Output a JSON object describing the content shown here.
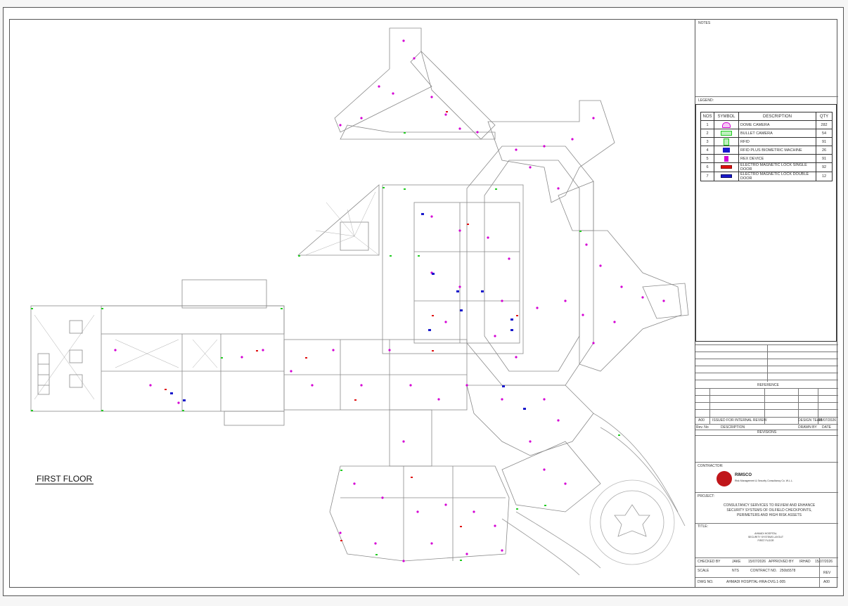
{
  "sheet": {
    "notes_label": "NOTES",
    "legend_label": "LEGEND:",
    "floor_title": "FIRST FLOOR"
  },
  "legend": {
    "headers": [
      "NOS",
      "SYMBOL",
      "DESCRIPTION",
      "QTY"
    ],
    "rows": [
      {
        "nos": "1",
        "description": "DOME CAMERA",
        "qty": "282",
        "color": "#d400d4",
        "icon": "dome-camera-icon"
      },
      {
        "nos": "2",
        "description": "BULLET CAMERA",
        "qty": "54",
        "color": "#22cc22",
        "icon": "bullet-camera-icon"
      },
      {
        "nos": "3",
        "description": "RFID",
        "qty": "91",
        "color": "#22cc22",
        "icon": "rfid-icon"
      },
      {
        "nos": "4",
        "description": "RFID PLUS BIOMETRIC MACHINE",
        "qty": "26",
        "color": "#1a1acc",
        "icon": "rfid-biometric-icon"
      },
      {
        "nos": "5",
        "description": "REX DEVICE",
        "qty": "91",
        "color": "#d400d4",
        "icon": "rex-device-icon"
      },
      {
        "nos": "6",
        "description": "ELECTRO MAGNETIC LOCK SINGLE DOOR",
        "qty": "92",
        "color": "#e01010",
        "icon": "maglock-single-icon"
      },
      {
        "nos": "7",
        "description": "ELECTRO MAGNETIC LOCK DOUBLE DOOR",
        "qty": "12",
        "color": "#1a1acc",
        "icon": "maglock-double-icon"
      }
    ]
  },
  "titleblock": {
    "reference_label": "REFERENCE",
    "revisions_label": "REVISIONS",
    "rev": {
      "no": "A00",
      "description": "ISSUED FOR INTERNAL REVIEW",
      "drawn_by": "DESIGN TEAM",
      "date": "15/07/2026"
    },
    "rev_headers": {
      "no": "Rev. No",
      "description": "DESCRIPTION",
      "drawn_by": "DRAWN BY",
      "date": "DATE"
    },
    "contractor_label": "CONTRACTOR:",
    "contractor_name": "RIMSCO",
    "contractor_sub": "Risk Management & Security Consultancy Co. W.L.L.",
    "project_label": "PROJECT:",
    "project_text": "CONSULTANCY SERVICES TO REVIEW AND ENHANCE SECURITY SYSTEMS OF OILFIELD CHECKPOINTS, PERIMETERS AND HIGH RISK ASSETS",
    "title_label": "TITLE:",
    "title_lines": [
      "AHMADI HOSPITAL",
      "SECURITY SYSTEMS LAYOUT",
      "FIRST FLOOR"
    ],
    "checked_by_label": "CHECKED BY",
    "checked_by": "JAKE",
    "checked_date": "15/07/2026",
    "approved_by_label": "APPROVED BY",
    "approved_by": "IRHAD",
    "approved_date": "15/07/2026",
    "scale_label": "SCALE",
    "scale": "NTS",
    "contract_label": "CONTRACT NO.",
    "contract_no": "250b5578",
    "rev_label": "REV",
    "dwg_label": "DWG NO.",
    "dwg_no": "AHMADI HOSPITAL-HRA-DVG.1-005",
    "rev_value": "A00"
  },
  "colors": {
    "dome": "#d400d4",
    "bullet": "#22cc22",
    "lock_single": "#e01010",
    "lock_double": "#1a1acc",
    "linework": "#8a8a8a"
  }
}
